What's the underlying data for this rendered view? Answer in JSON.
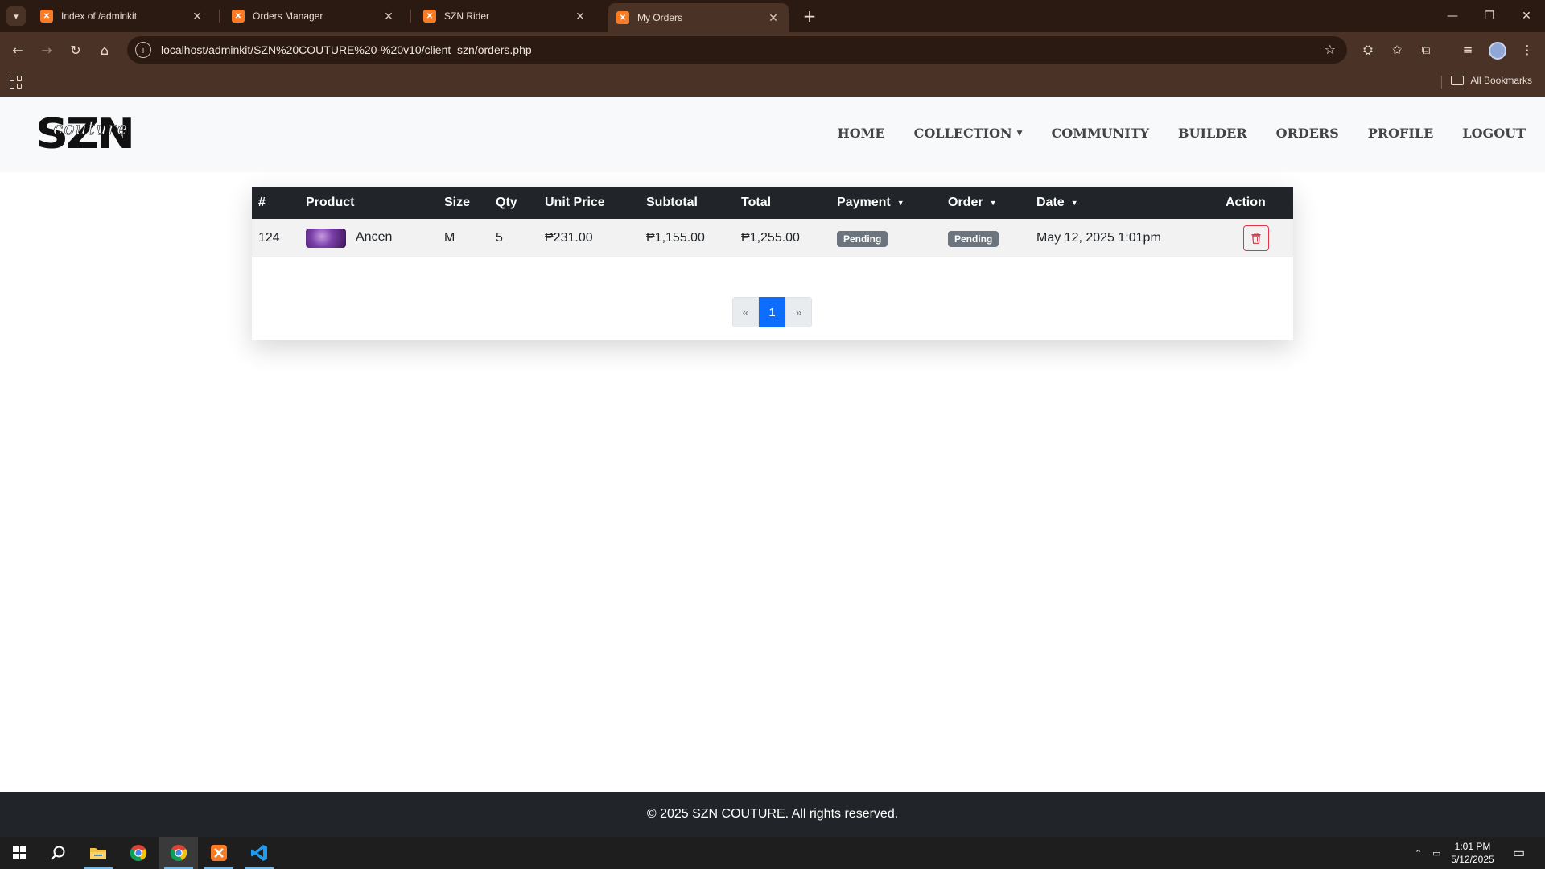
{
  "browser": {
    "tabs": [
      {
        "title": "Index of /adminkit",
        "active": false
      },
      {
        "title": "Orders Manager",
        "active": false
      },
      {
        "title": "SZN Rider",
        "active": false
      },
      {
        "title": "My Orders",
        "active": true
      }
    ],
    "url": "localhost/adminkit/SZN%20COUTURE%20-%20v10/client_szn/orders.php",
    "bookmarks_label": "All Bookmarks"
  },
  "site": {
    "logo_text": "SZN",
    "logo_script": "couture",
    "menu": [
      {
        "label": "HOME"
      },
      {
        "label": "COLLECTION",
        "dropdown": true
      },
      {
        "label": "COMMUNITY"
      },
      {
        "label": "BUILDER"
      },
      {
        "label": "ORDERS"
      },
      {
        "label": "PROFILE"
      },
      {
        "label": "LOGOUT"
      }
    ]
  },
  "orders_table": {
    "headers": [
      "#",
      "Product",
      "Size",
      "Qty",
      "Unit Price",
      "Subtotal",
      "Total",
      "Payment",
      "Order",
      "Date",
      "Action"
    ],
    "rows": [
      {
        "id": "124",
        "product": "Ancen",
        "size": "M",
        "qty": "5",
        "unit_price": "₱231.00",
        "subtotal": "₱1,155.00",
        "total": "₱1,255.00",
        "payment_status": "Pending",
        "order_status": "Pending",
        "date": "May 12, 2025 1:01pm",
        "action_icon": "trash-icon"
      }
    ]
  },
  "pagination": {
    "prev": "«",
    "current": "1",
    "next": "»"
  },
  "footer": {
    "text": "© 2025 SZN COUTURE. All rights reserved."
  },
  "taskbar": {
    "time": "1:01 PM",
    "date": "5/12/2025"
  },
  "colors": {
    "chrome_dark": "#2b1a12",
    "chrome_toolbar": "#4a3226",
    "table_header": "#212529",
    "badge": "#6c757d",
    "danger": "#dc3545",
    "primary": "#0d6efd"
  }
}
